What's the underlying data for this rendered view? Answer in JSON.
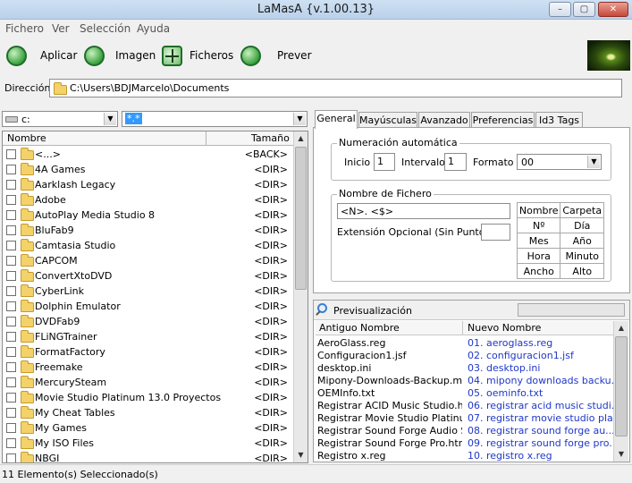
{
  "window": {
    "title": "LaMasA {v.1.00.13}",
    "minimize": "–",
    "maximize": "▢",
    "close": "✕"
  },
  "menu": [
    "Fichero",
    "Ver",
    "Selección",
    "Ayuda"
  ],
  "toolbar": {
    "apply_label": "Aplicar",
    "image_label": "Imagen",
    "files_label": "Ficheros",
    "preview_label": "Prever"
  },
  "directory": {
    "label": "Dirección",
    "path": "C:\\Users\\BDJMarcelo\\Documents"
  },
  "drive": {
    "value": "c:"
  },
  "filter": {
    "value": "*.*"
  },
  "file_list": {
    "columns": {
      "name": "Nombre",
      "size": "Tamaño"
    },
    "rows": [
      {
        "name": "<...>",
        "size": "<BACK>"
      },
      {
        "name": "4A Games",
        "size": "<DIR>"
      },
      {
        "name": "Aarklash Legacy",
        "size": "<DIR>"
      },
      {
        "name": "Adobe",
        "size": "<DIR>"
      },
      {
        "name": "AutoPlay Media Studio 8",
        "size": "<DIR>"
      },
      {
        "name": "BluFab9",
        "size": "<DIR>"
      },
      {
        "name": "Camtasia Studio",
        "size": "<DIR>"
      },
      {
        "name": "CAPCOM",
        "size": "<DIR>"
      },
      {
        "name": "ConvertXtoDVD",
        "size": "<DIR>"
      },
      {
        "name": "CyberLink",
        "size": "<DIR>"
      },
      {
        "name": "Dolphin Emulator",
        "size": "<DIR>"
      },
      {
        "name": "DVDFab9",
        "size": "<DIR>"
      },
      {
        "name": "FLiNGTrainer",
        "size": "<DIR>"
      },
      {
        "name": "FormatFactory",
        "size": "<DIR>"
      },
      {
        "name": "Freemake",
        "size": "<DIR>"
      },
      {
        "name": "MercurySteam",
        "size": "<DIR>"
      },
      {
        "name": "Movie Studio Platinum 13.0 Proyectos",
        "size": "<DIR>"
      },
      {
        "name": "My Cheat Tables",
        "size": "<DIR>"
      },
      {
        "name": "My Games",
        "size": "<DIR>"
      },
      {
        "name": "My ISO Files",
        "size": "<DIR>"
      },
      {
        "name": "NBGI",
        "size": "<DIR>"
      }
    ]
  },
  "tabs": [
    "General",
    "Mayúsculas",
    "Avanzado",
    "Preferencias",
    "Id3 Tags"
  ],
  "numbering": {
    "title": "Numeración automática",
    "start_label": "Inicio",
    "start_value": "1",
    "interval_label": "Intervalo",
    "interval_value": "1",
    "format_label": "Formato",
    "format_value": "00"
  },
  "filename": {
    "title": "Nombre de Fichero",
    "pattern": "<N>. <$>",
    "ext_label": "Extensión Opcional (Sin Punto):",
    "ext_value": "",
    "macros": [
      [
        "Nombre",
        "Carpeta"
      ],
      [
        "Nº",
        "Día"
      ],
      [
        "Mes",
        "Año"
      ],
      [
        "Hora",
        "Minuto"
      ],
      [
        "Ancho",
        "Alto"
      ]
    ]
  },
  "preview": {
    "title": "Previsualización",
    "columns": {
      "old": "Antiguo Nombre",
      "new": "Nuevo Nombre"
    },
    "rows": [
      {
        "old": "AeroGlass.reg",
        "new": "01. aeroglass.reg"
      },
      {
        "old": "Configuracion1.jsf",
        "new": "02. configuracion1.jsf"
      },
      {
        "old": "desktop.ini",
        "new": "03. desktop.ini"
      },
      {
        "old": "Mipony-Downloads-Backup.mpb",
        "new": "04. mipony downloads backu..."
      },
      {
        "old": "OEMInfo.txt",
        "new": "05. oeminfo.txt"
      },
      {
        "old": "Registrar ACID Music Studio.htm",
        "new": "06. registrar acid music studi..."
      },
      {
        "old": "Registrar Movie Studio Platinu...",
        "new": "07. registrar movie studio pla..."
      },
      {
        "old": "Registrar Sound Forge Audio S...",
        "new": "08. registrar sound forge au..."
      },
      {
        "old": "Registrar Sound Forge Pro.htm",
        "new": "09. registrar sound forge pro..."
      },
      {
        "old": "Registro x.reg",
        "new": "10. registro x.reg"
      }
    ]
  },
  "status": {
    "text": "11 Elemento(s) Seleccionado(s)"
  }
}
